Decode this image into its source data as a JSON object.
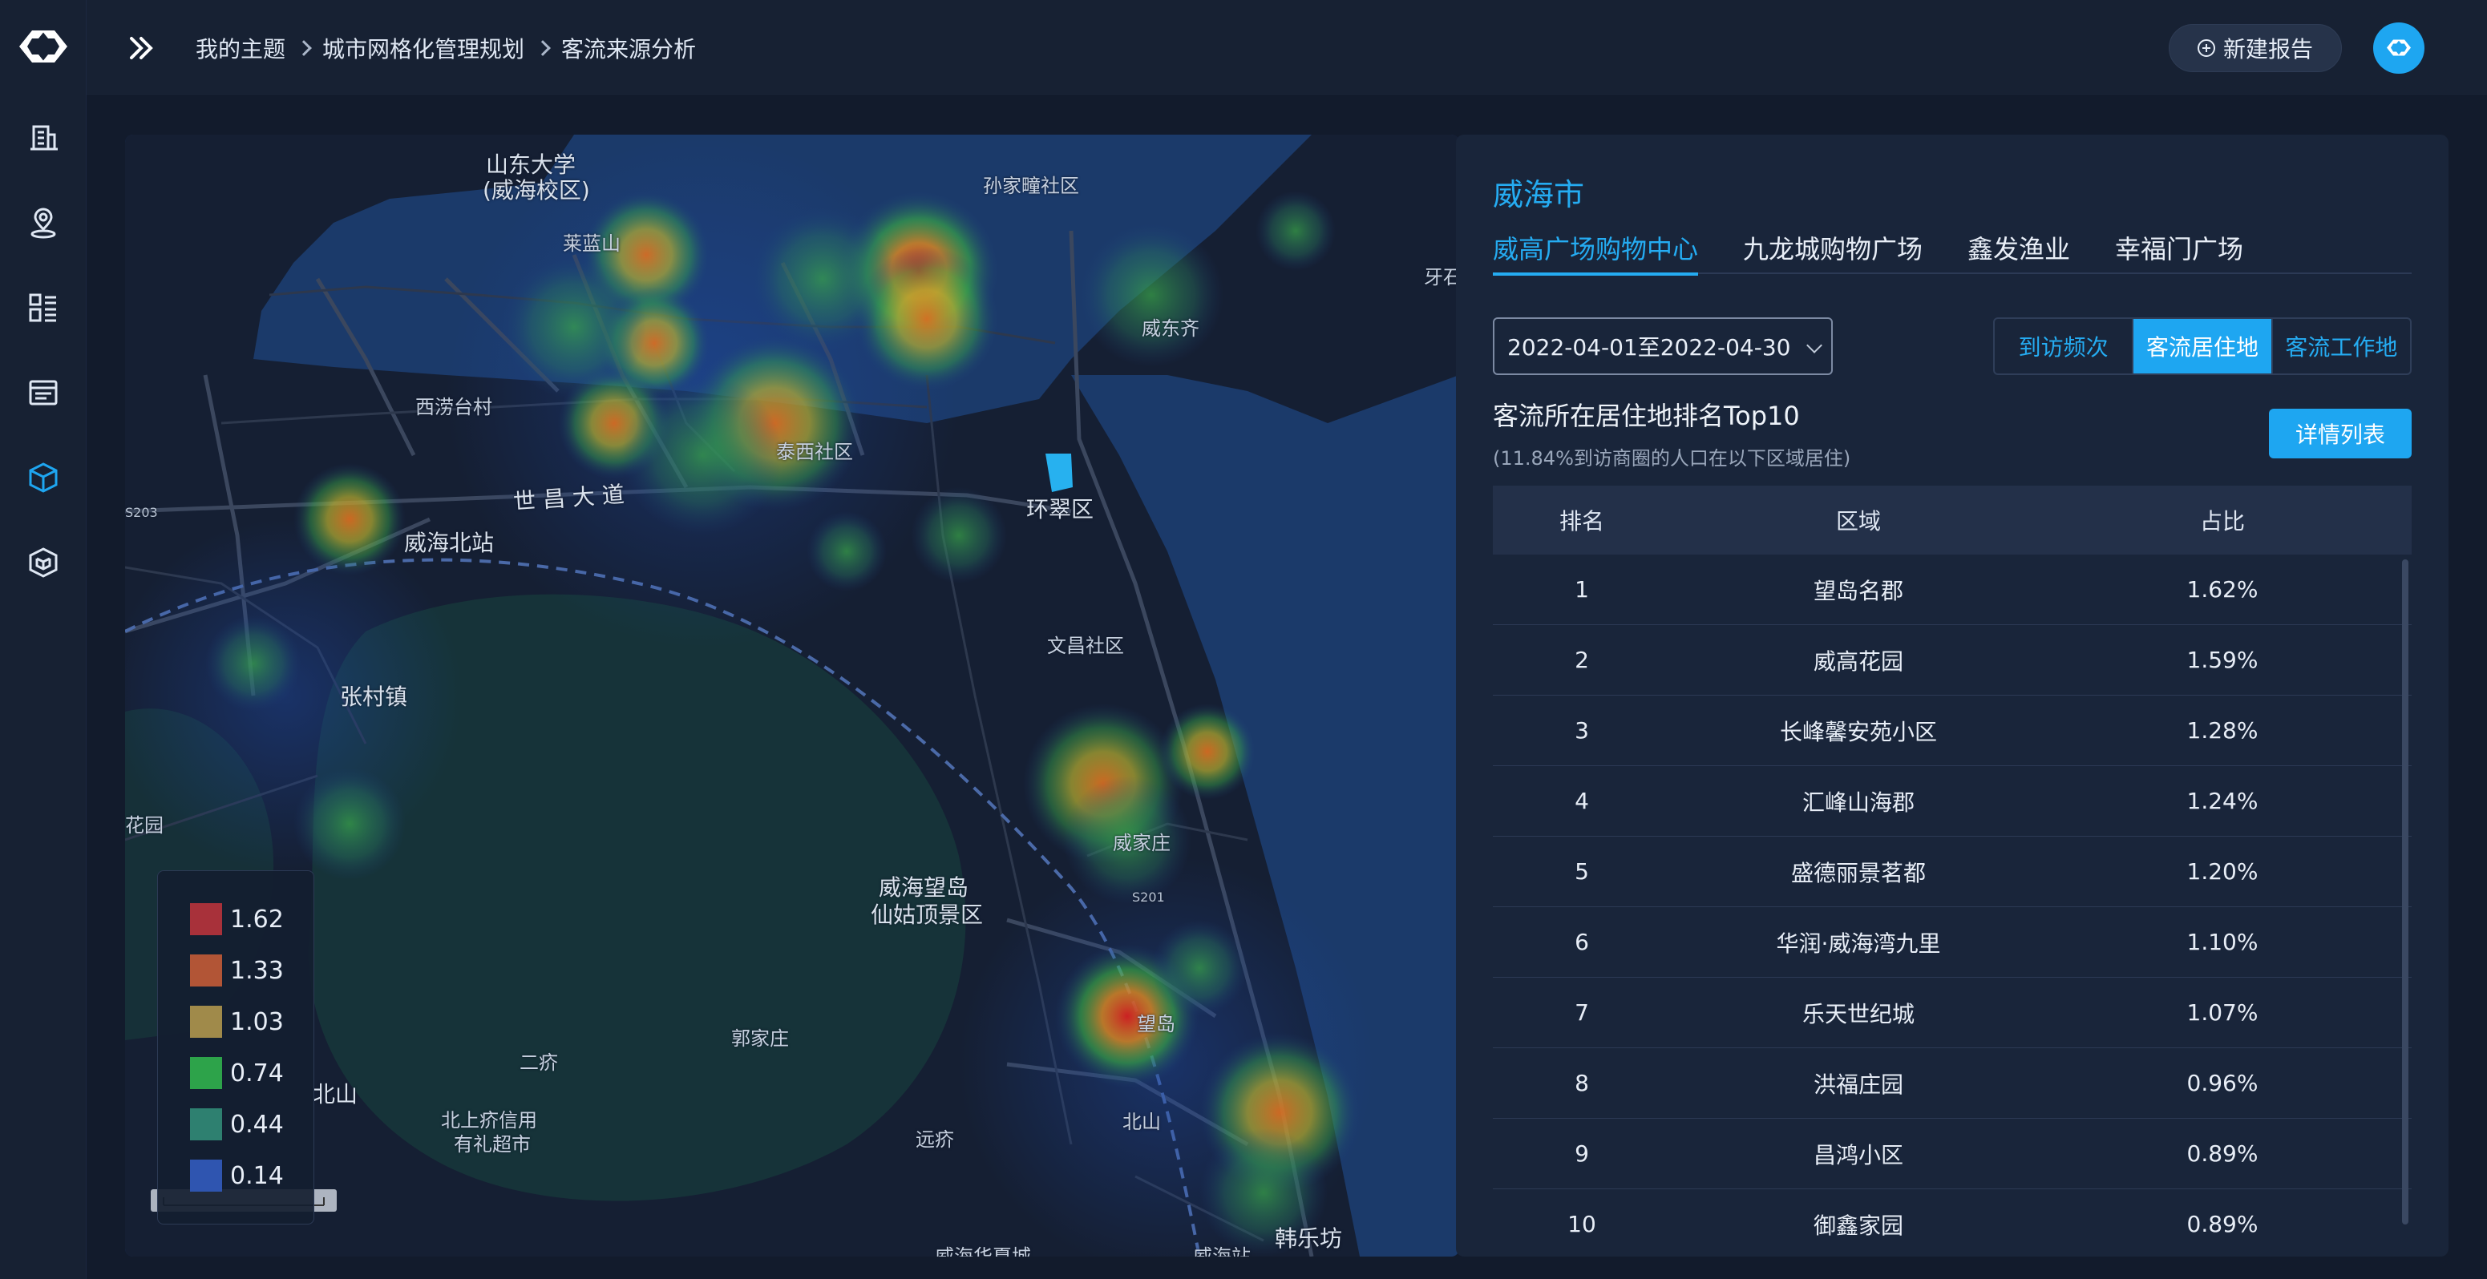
{
  "breadcrumb": [
    "我的主题",
    "城市网格化管理规划",
    "客流来源分析"
  ],
  "header": {
    "new_report_label": "新建报告"
  },
  "sidebar": {
    "items": [
      {
        "icon": "building-icon",
        "active": false
      },
      {
        "icon": "location-pin-icon",
        "active": false
      },
      {
        "icon": "dashboard-icon",
        "active": false
      },
      {
        "icon": "list-icon",
        "active": false
      },
      {
        "icon": "cube-icon",
        "active": true
      },
      {
        "icon": "package-icon",
        "active": false
      }
    ]
  },
  "map": {
    "labels": [
      {
        "text": "山东大学",
        "style": "big"
      },
      {
        "text": "(威海校区)",
        "style": "big"
      },
      {
        "text": "孙家疃社区",
        "style": "normal"
      },
      {
        "text": "莱蓝山",
        "style": "normal"
      },
      {
        "text": "威东齐",
        "style": "normal"
      },
      {
        "text": "牙石",
        "style": "normal"
      },
      {
        "text": "西涝台村",
        "style": "normal"
      },
      {
        "text": "泰西社区",
        "style": "normal"
      },
      {
        "text": "世 昌 大 道",
        "style": "big"
      },
      {
        "text": "环翠区",
        "style": "big"
      },
      {
        "text": "S203",
        "style": "small"
      },
      {
        "text": "威海北站",
        "style": "big"
      },
      {
        "text": "文昌社区",
        "style": "normal"
      },
      {
        "text": "张村镇",
        "style": "big"
      },
      {
        "text": "花园",
        "style": "normal"
      },
      {
        "text": "威家庄",
        "style": "normal"
      },
      {
        "text": "威海望岛",
        "style": "big"
      },
      {
        "text": "仙姑顶景区",
        "style": "big"
      },
      {
        "text": "S201",
        "style": "small"
      },
      {
        "text": "望岛",
        "style": "normal"
      },
      {
        "text": "郭家庄",
        "style": "normal"
      },
      {
        "text": "二疥",
        "style": "normal"
      },
      {
        "text": "北山",
        "style": "big"
      },
      {
        "text": "北上疥信用",
        "style": "normal"
      },
      {
        "text": "有礼超市",
        "style": "normal"
      },
      {
        "text": "远疥",
        "style": "normal"
      },
      {
        "text": "北山",
        "style": "normal"
      },
      {
        "text": "韩乐坊",
        "style": "big"
      },
      {
        "text": "威海华夏城",
        "style": "normal"
      },
      {
        "text": "威海站",
        "style": "normal"
      }
    ],
    "legend": [
      {
        "value": "1.62",
        "color": "#a8313a"
      },
      {
        "value": "1.33",
        "color": "#b25536"
      },
      {
        "value": "1.03",
        "color": "#a08a4a"
      },
      {
        "value": "0.74",
        "color": "#2da34a"
      },
      {
        "value": "0.44",
        "color": "#2e8070"
      },
      {
        "value": "0.14",
        "color": "#2f55b0"
      }
    ]
  },
  "panel": {
    "city": "威海市",
    "tabs": [
      "威高广场购物中心",
      "九龙城购物广场",
      "鑫发渔业",
      "幸福门广场"
    ],
    "active_tab": 0,
    "date_range": "2022-04-01至2022-04-30",
    "segments": [
      "到访频次",
      "客流居住地",
      "客流工作地"
    ],
    "active_segment": 1,
    "title": "客流所在居住地排名Top10",
    "subtitle": "(11.84%到访商圈的人口在以下区域居住)",
    "detail_button": "详情列表",
    "table": {
      "headers": [
        "排名",
        "区域",
        "占比"
      ],
      "rows": [
        [
          "1",
          "望岛名郡",
          "1.62%"
        ],
        [
          "2",
          "威高花园",
          "1.59%"
        ],
        [
          "3",
          "长峰馨安苑小区",
          "1.28%"
        ],
        [
          "4",
          "汇峰山海郡",
          "1.24%"
        ],
        [
          "5",
          "盛德丽景茗都",
          "1.20%"
        ],
        [
          "6",
          "华润·威海湾九里",
          "1.10%"
        ],
        [
          "7",
          "乐天世纪城",
          "1.07%"
        ],
        [
          "8",
          "洪福庄园",
          "0.96%"
        ],
        [
          "9",
          "昌鸿小区",
          "0.89%"
        ],
        [
          "10",
          "御鑫家园",
          "0.89%"
        ]
      ]
    }
  },
  "colors": {
    "accent": "#1ea6f1",
    "background": "#121b2c",
    "panel": "#19253a"
  }
}
